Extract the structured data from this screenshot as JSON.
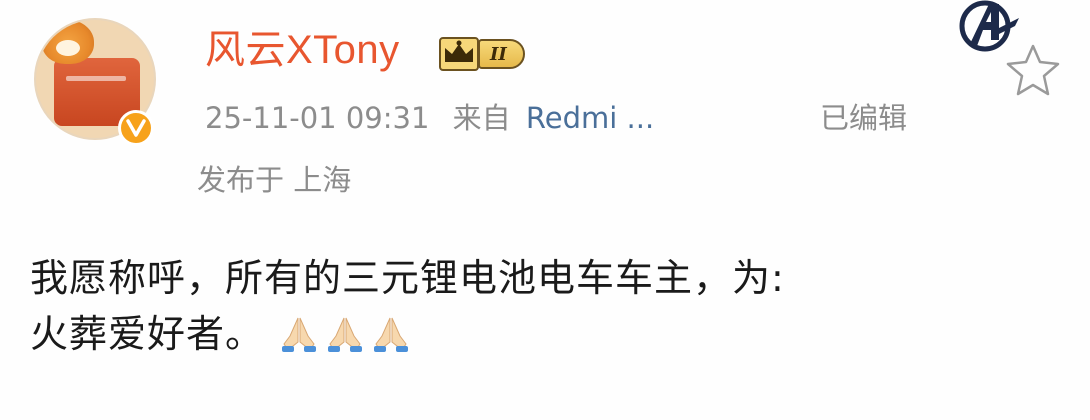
{
  "post": {
    "username": "风云XTony",
    "level": "II",
    "timestamp": "25-11-01 09:31",
    "source_prefix": "来自",
    "source_device": "Redmi ...",
    "edited_label": "已编辑",
    "location": "发布于 上海",
    "text_line1": "我愿称呼，所有的三元锂电池电车车主，为:",
    "text_line2": "火葬爱好者。"
  },
  "colors": {
    "username": "#e8562f",
    "meta": "#8c8c8c",
    "link": "#4a6f99",
    "badge_gold": "#e6b94a",
    "verified": "#f7a21b"
  },
  "icons": {
    "verified": "verified-v-icon",
    "crown": "crown-icon",
    "avengers": "avengers-logo-icon",
    "favorite": "star-outline-icon",
    "pray": "folded-hands-icon"
  }
}
